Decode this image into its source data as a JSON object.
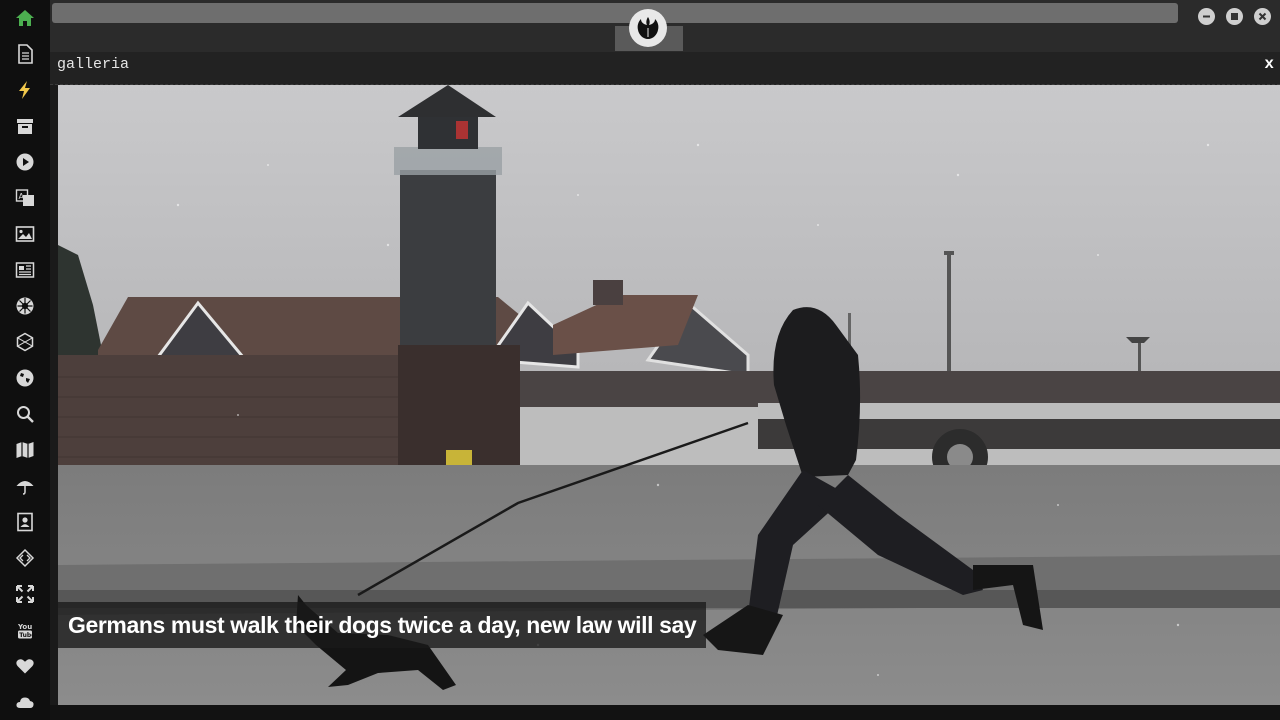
{
  "sidebar": {
    "items": [
      {
        "icon": "home-icon",
        "color": "#4caf50"
      },
      {
        "icon": "document-icon"
      },
      {
        "icon": "lightning-icon",
        "color": "#f2c94c"
      },
      {
        "icon": "archive-icon"
      },
      {
        "icon": "play-icon"
      },
      {
        "icon": "translate-icon"
      },
      {
        "icon": "image-icon"
      },
      {
        "icon": "newspaper-icon"
      },
      {
        "icon": "empire-icon"
      },
      {
        "icon": "hexagon-icon"
      },
      {
        "icon": "globe-icon"
      },
      {
        "icon": "search-icon"
      },
      {
        "icon": "map-icon"
      },
      {
        "icon": "umbrella-icon"
      },
      {
        "icon": "contact-icon"
      },
      {
        "icon": "code-icon"
      },
      {
        "icon": "expand-icon"
      },
      {
        "icon": "youtube-icon"
      },
      {
        "icon": "heart-icon"
      },
      {
        "icon": "cloud-icon"
      }
    ]
  },
  "topbar": {
    "logo_icon": "rebel-alliance-icon",
    "window_controls": [
      "minimize-icon",
      "maximize-icon",
      "close-icon"
    ]
  },
  "panel": {
    "title": "galleria",
    "close_label": "x"
  },
  "gallery": {
    "caption": "Germans must walk their dogs twice a day, new law will say"
  }
}
